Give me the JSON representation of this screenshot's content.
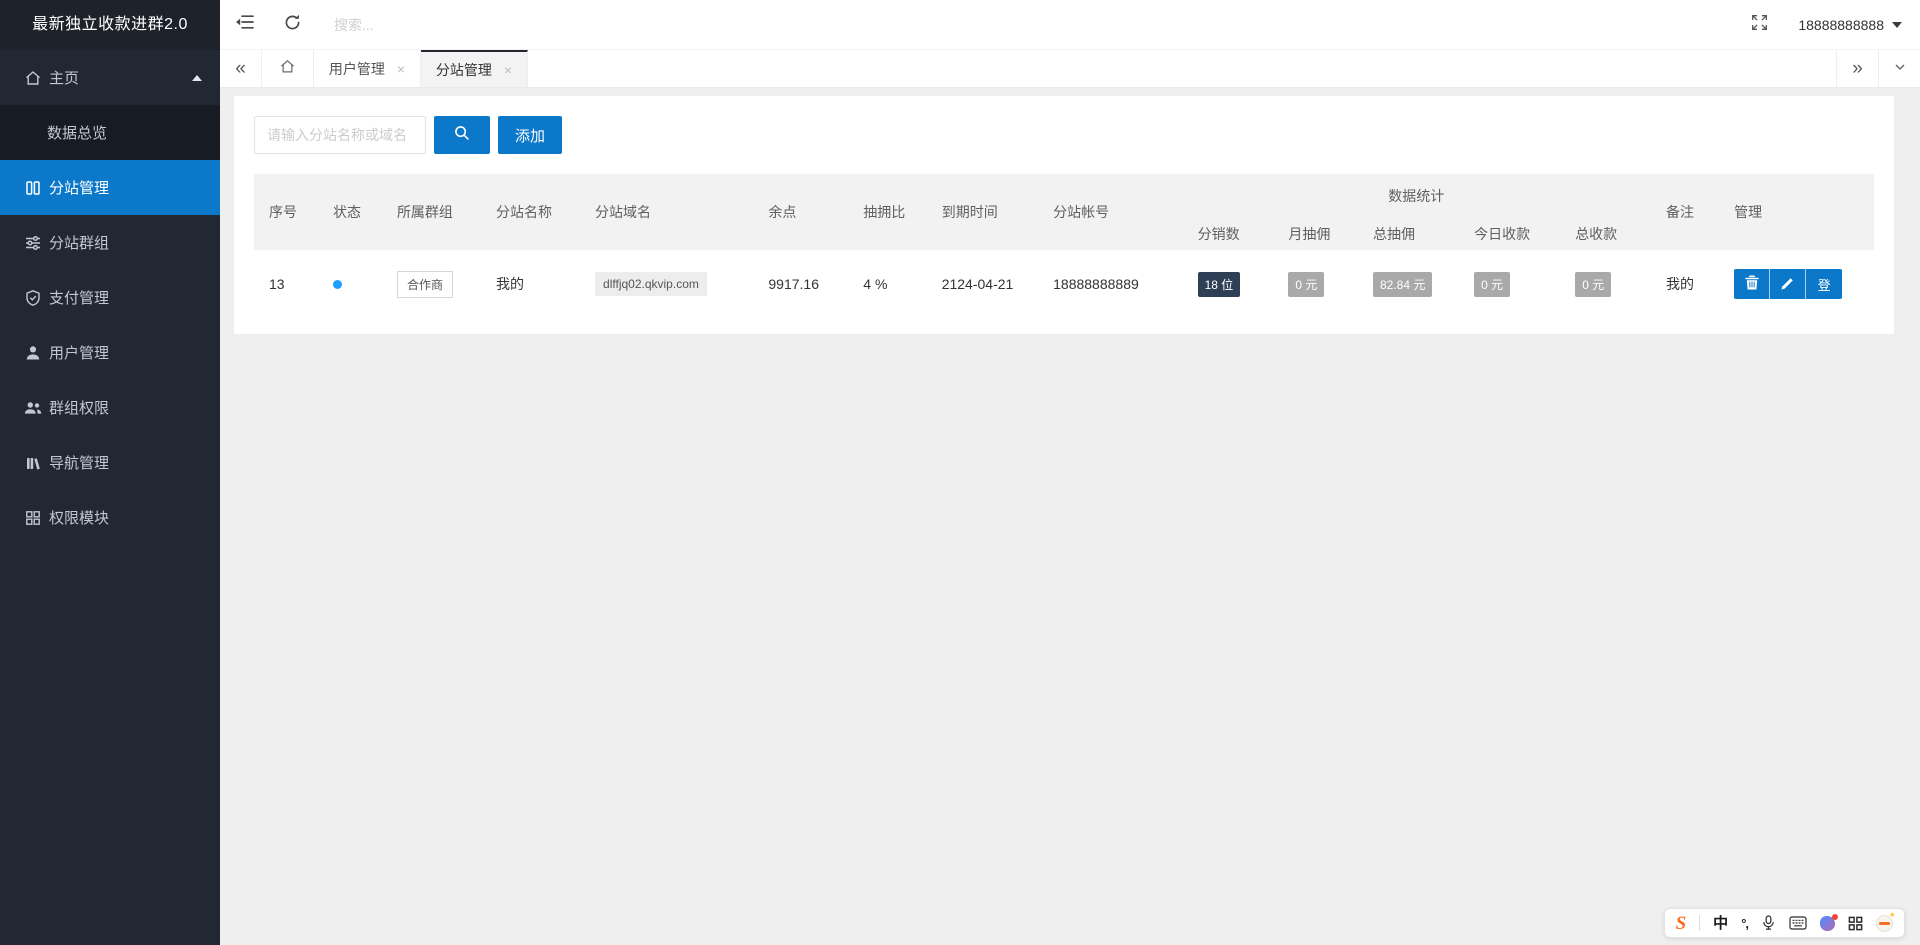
{
  "app": {
    "logo_title": "最新独立收款进群2.0"
  },
  "colors": {
    "accent_blue": "#0c78c9",
    "sidebar_bg": "#222833",
    "status_dot_blue": "#1e9fff",
    "badge_dark": "#2f4056",
    "badge_gray": "#a9a9a9",
    "active_tab_top_border": "#23272f"
  },
  "sidebar": {
    "items": [
      {
        "label": "主页",
        "icon": "home-icon",
        "expanded": true
      },
      {
        "label": "数据总览",
        "submenu_of": "主页"
      },
      {
        "label": "分站管理",
        "icon": "columns-icon",
        "active": true
      },
      {
        "label": "分站群组",
        "icon": "sliders-icon"
      },
      {
        "label": "支付管理",
        "icon": "shield-check-icon"
      },
      {
        "label": "用户管理",
        "icon": "user-icon"
      },
      {
        "label": "群组权限",
        "icon": "users-icon"
      },
      {
        "label": "导航管理",
        "icon": "books-icon"
      },
      {
        "label": "权限模块",
        "icon": "grid-icon"
      }
    ]
  },
  "topbar": {
    "search_placeholder": "搜索...",
    "username": "18888888888"
  },
  "tabbar": {
    "back_glyph": "«",
    "forward_glyph": "»",
    "tabs": [
      {
        "label": "用户管理",
        "close_glyph": "×",
        "active": false
      },
      {
        "label": "分站管理",
        "close_glyph": "×",
        "active": true
      }
    ]
  },
  "toolbar": {
    "filter_placeholder": "请输入分站名称或域名",
    "add_label": "添加"
  },
  "table": {
    "group_header": "数据统计",
    "headers": [
      "序号",
      "状态",
      "所属群组",
      "分站名称",
      "分站域名",
      "余点",
      "抽拥比",
      "到期时间",
      "分站帐号"
    ],
    "stat_headers": [
      "分销数",
      "月抽佣",
      "总抽佣",
      "今日收款",
      "总收款"
    ],
    "tail_headers": [
      "备注",
      "管理"
    ],
    "rows": [
      {
        "seq": "13",
        "status": "online",
        "group": "合作商",
        "name": "我的",
        "domain": "dlffjq02.qkvip.com",
        "balance": "9917.16",
        "rate": "4 %",
        "expire": "2124-04-21",
        "account": "18888888889",
        "distributors": "18 位",
        "month_commission": "0 元",
        "total_commission": "82.84 元",
        "today_income": "0 元",
        "total_income": "0 元",
        "remark": "我的",
        "login_label": "登"
      }
    ]
  },
  "ime": {
    "logo": "S",
    "mode": "中",
    "punct": "°,"
  }
}
